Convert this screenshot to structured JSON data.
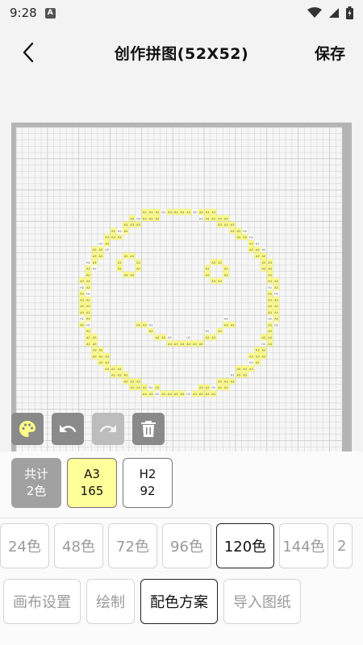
{
  "status_bar": {
    "time": "9:28",
    "badge": "A"
  },
  "header": {
    "title": "创作拼图(52X52)",
    "save_label": "保存"
  },
  "canvas": {
    "grid_columns": 52,
    "grid_rows": 52,
    "bead_labels": {
      "yellow": "A3",
      "white": "H2"
    },
    "colors": {
      "yellow": "#ffff88",
      "white": "#ffffff",
      "grid_line": "#c8c8c8",
      "ruler": "#b4b4b4",
      "background": "#f6f6f6"
    }
  },
  "tools": [
    {
      "name": "palette-icon",
      "enabled": true
    },
    {
      "name": "undo-icon",
      "enabled": true
    },
    {
      "name": "redo-icon",
      "enabled": false
    },
    {
      "name": "trash-icon",
      "enabled": true
    }
  ],
  "swatches": {
    "total": {
      "line1": "共计",
      "line2": "2色"
    },
    "a3": {
      "code": "A3",
      "count": "165",
      "color": "#ffff99"
    },
    "h2": {
      "code": "H2",
      "count": "92",
      "color": "#ffffff"
    }
  },
  "color_counts": {
    "options": [
      "24色",
      "48色",
      "72色",
      "96色",
      "120色",
      "144色",
      "2"
    ],
    "selected": "120色"
  },
  "menu": {
    "items": [
      "画布设置",
      "绘制",
      "配色方案",
      "导入图纸"
    ],
    "selected": "配色方案"
  }
}
